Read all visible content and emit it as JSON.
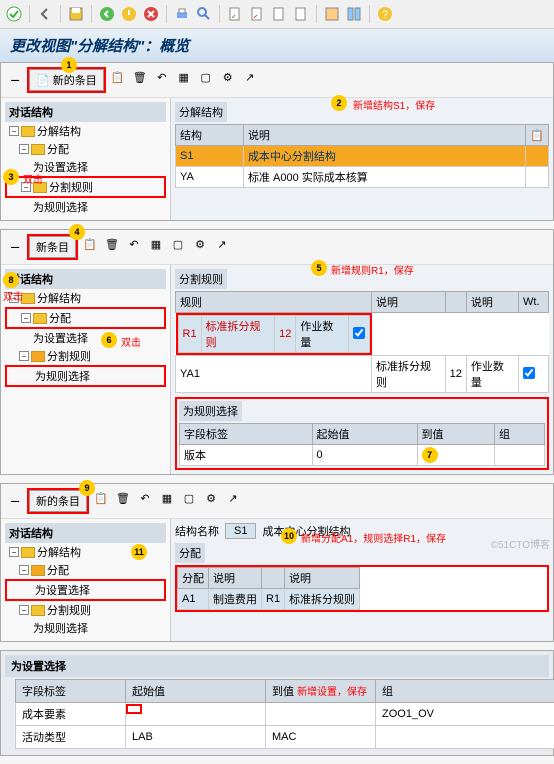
{
  "toolbar": {
    "check": "✓",
    "back": "◀",
    "save": "💾"
  },
  "title": "更改视图\"分解结构\"：概览",
  "subtool": {
    "new_entry": "新的条目"
  },
  "tree_hdr": "对话结构",
  "tree": {
    "n1": "分解结构",
    "n2": "分配",
    "n3": "为设置选择",
    "n4": "分割规则",
    "n5": "为规则选择"
  },
  "sec1": {
    "grp": "分解结构",
    "c1": "结构",
    "c2": "说明",
    "r1a": "S1",
    "r1b": "成本中心分割结构",
    "r2a": "YA",
    "r2b": "标准 A000 实际成本核算",
    "note": "新增结构S1，保存"
  },
  "sec2": {
    "new": "新条目",
    "grp": "分割规则",
    "c1": "规则",
    "c2": "说明",
    "c3": "",
    "c4": "说明",
    "c5": "Wt.",
    "r1a": "R1",
    "r1b": "标准拆分规则",
    "r1c": "12",
    "r1d": "作业数量",
    "r2a": "YA1",
    "r2b": "标准拆分规则",
    "r2c": "12",
    "r2d": "作业数量",
    "note5": "新增规则R1，保存",
    "sub_grp": "为规则选择",
    "sc1": "字段标签",
    "sc2": "起始值",
    "sc3": "到值",
    "sc4": "组",
    "sr1": "版本",
    "sr2": "0"
  },
  "notes": {
    "n3": "双击",
    "n6": "双击",
    "n8": "双击"
  },
  "sec3": {
    "new": "新的条目",
    "hdr": "结构名称",
    "hdrv": "S1",
    "hdrd": "成本中心分割结构",
    "grp": "分配",
    "c1": "分配",
    "c2": "说明",
    "c3": "",
    "c4": "说明",
    "r1a": "A1",
    "r1b": "制造费用",
    "r1c": "R1",
    "r1d": "标准拆分规则",
    "note10": "新增分配A1，规则选择R1，保存"
  },
  "sec4": {
    "title": "为设置选择",
    "c1": "字段标签",
    "c2": "起始值",
    "c3": "到值",
    "c4": "组",
    "note": "新增设置，保存",
    "r1a": "成本要素",
    "r1d": "ZOO1_OV",
    "r2a": "活动类型",
    "r2b": "LAB",
    "r2c": "MAC"
  },
  "watermark": "©51CTO博客"
}
